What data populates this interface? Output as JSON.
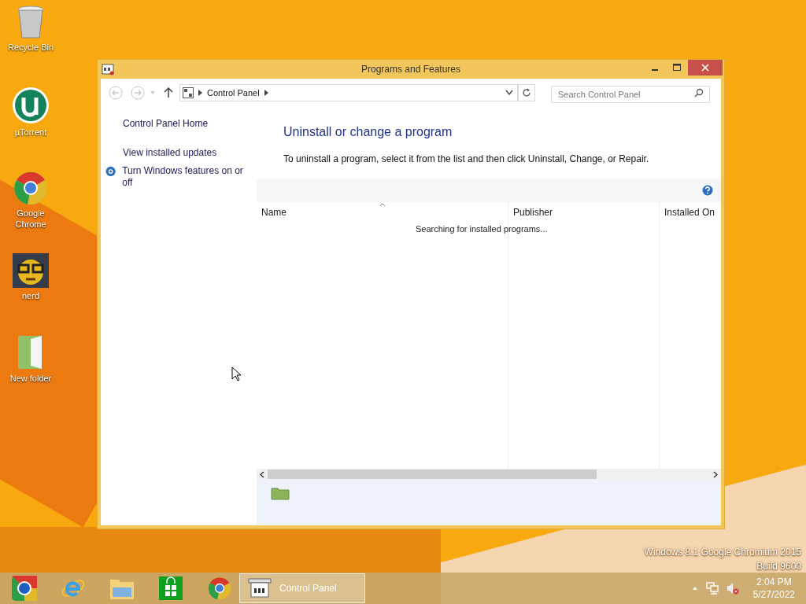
{
  "desktop_icons": [
    {
      "label": "Recycle Bin",
      "kind": "bin"
    },
    {
      "label": "µTorrent",
      "kind": "torrent"
    },
    {
      "label": "Google Chrome",
      "kind": "chrome"
    },
    {
      "label": "nerd",
      "kind": "nerd"
    },
    {
      "label": "New folder",
      "kind": "folder"
    }
  ],
  "window": {
    "title": "Programs and Features",
    "breadcrumb": [
      "Control Panel"
    ],
    "search": {
      "placeholder": "Search Control Panel"
    },
    "sidebar": [
      {
        "label": "Control Panel Home",
        "kind": "link"
      },
      {
        "label": "View installed updates",
        "kind": "link"
      },
      {
        "label": "Turn Windows features on or off",
        "kind": "shield"
      }
    ],
    "heading": "Uninstall or change a program",
    "instructions": "To uninstall a program, select it from the list and then click Uninstall, Change, or Repair.",
    "table": {
      "columns": [
        "Name",
        "Publisher",
        "Installed On"
      ],
      "status": "Searching for installed programs..."
    }
  },
  "watermark": [
    "Windows 8.1 Google Chromium 2015",
    "Build 9600"
  ],
  "taskbar": {
    "pinned": [
      {
        "kind": "chromium"
      },
      {
        "kind": "ie"
      },
      {
        "kind": "explorer"
      },
      {
        "kind": "store"
      },
      {
        "kind": "chrome"
      }
    ],
    "tasks": [
      {
        "label": "Control Panel",
        "selected": true
      }
    ],
    "time": "2:04 PM",
    "date": "5/27/2022"
  }
}
